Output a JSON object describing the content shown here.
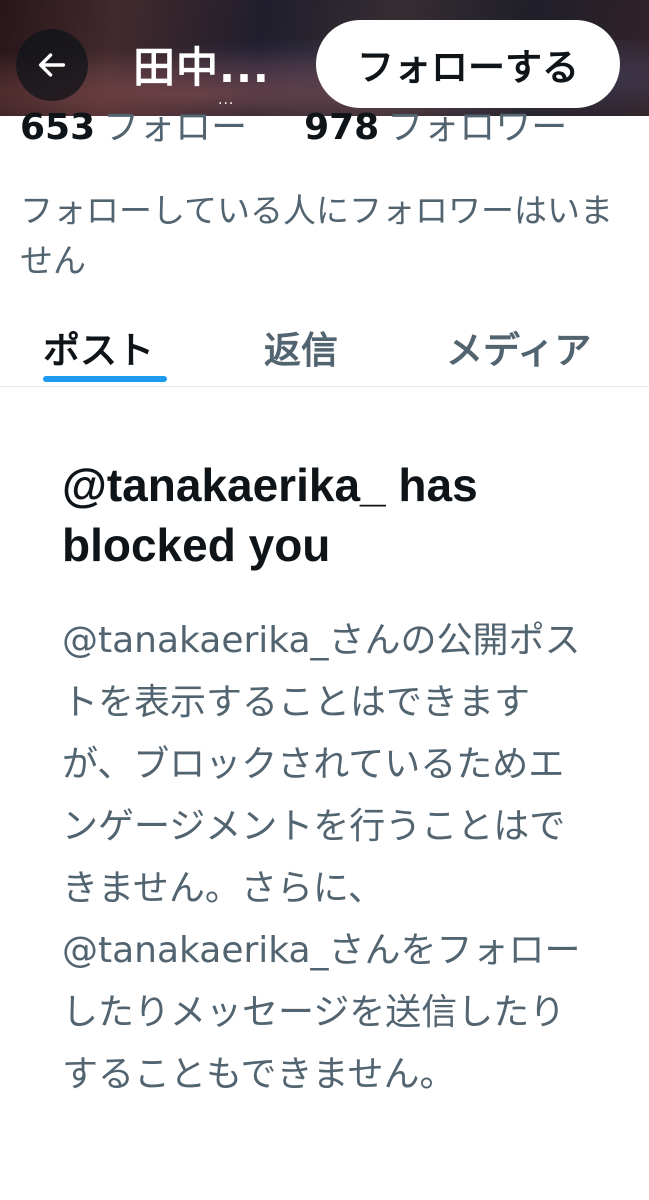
{
  "header": {
    "back_icon": "arrow-left-icon",
    "display_name": "田中...",
    "sub_text": "...",
    "follow_button": "フォローする"
  },
  "profile": {
    "following_count": "653",
    "following_label": "フォロー",
    "followers_count": "978",
    "followers_label": "フォロワー",
    "followers_you_know": "フォローしている人にフォロワーはいません"
  },
  "tabs": [
    {
      "label": "ポスト",
      "active": true
    },
    {
      "label": "返信",
      "active": false
    },
    {
      "label": "メディア",
      "active": false
    }
  ],
  "blocked": {
    "title": "@tanakaerika_ has blocked you",
    "body": "@tanakaerika_さんの公開ポストを表示することはできますが、ブロックされているためエンゲージメントを行うことはできません。さらに、@tanakaerika_さんをフォローしたりメッセージを送信したりすることもできません。"
  },
  "colors": {
    "accent": "#1d9bf0",
    "text_primary": "#0f1419",
    "text_secondary": "#536471",
    "divider": "#e6e9eb"
  }
}
